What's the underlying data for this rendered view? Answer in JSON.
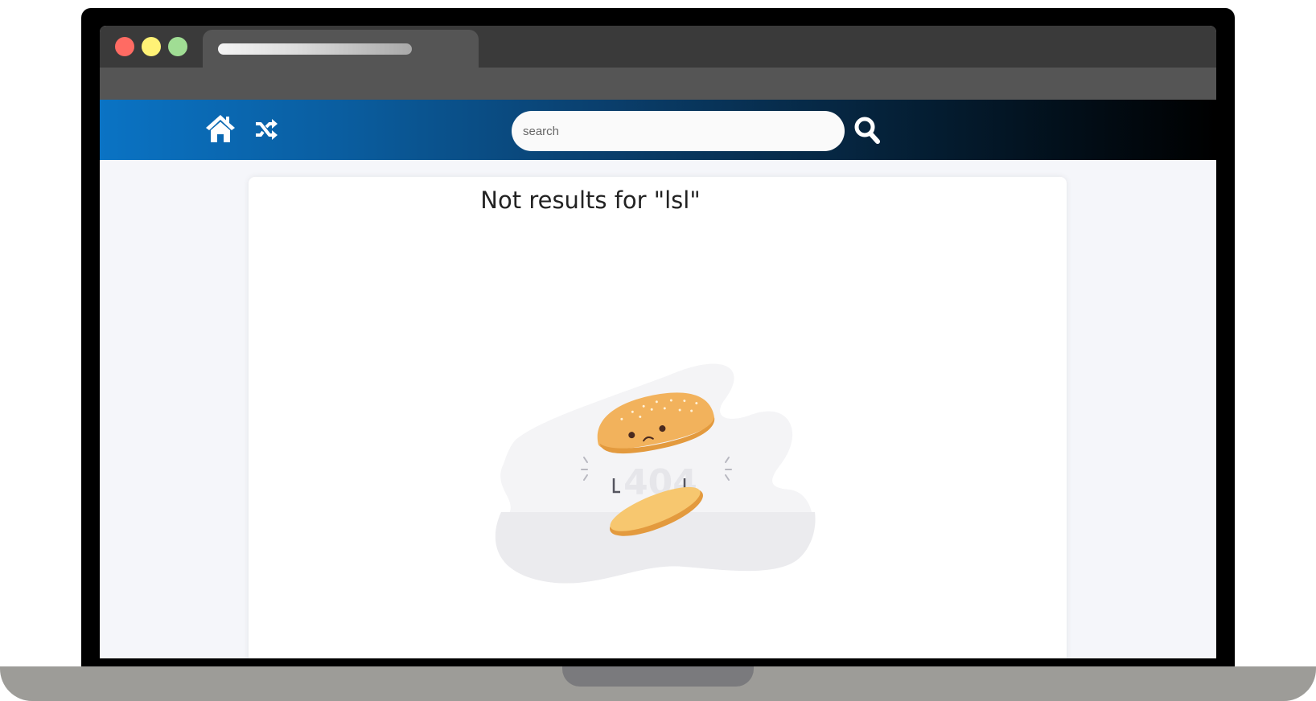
{
  "browser": {
    "window_controls": [
      "close",
      "minimize",
      "maximize"
    ]
  },
  "navbar": {
    "icons": [
      "home-icon",
      "shuffle-icon",
      "search-icon"
    ],
    "search": {
      "placeholder": "search",
      "value": ""
    },
    "gradient_colors": [
      "#0a73c4",
      "#000000"
    ]
  },
  "main": {
    "title": "Not results for \"lsl\""
  },
  "illustration": {
    "depicts": "sad-burger-bun-404",
    "text": "404"
  },
  "colors": {
    "traffic_red": "#ff6b63",
    "traffic_yellow": "#fff276",
    "traffic_green": "#a0dd94",
    "bun": "#f2b25c"
  }
}
